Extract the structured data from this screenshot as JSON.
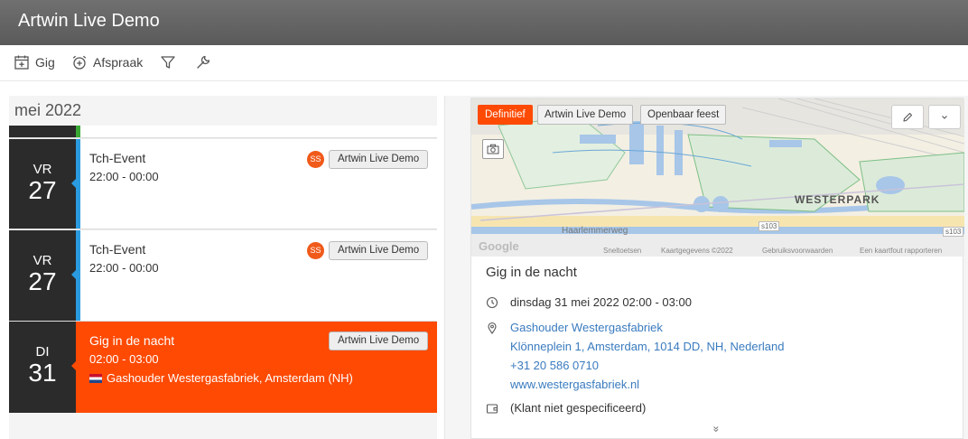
{
  "app": {
    "title": "Artwin Live Demo"
  },
  "toolbar": {
    "gig_label": "Gig",
    "afspraak_label": "Afspraak"
  },
  "list": {
    "month": "mei 2022",
    "events": [
      {
        "dow": "VR",
        "day": "27",
        "title": "Tch-Event",
        "time": "22:00 - 00:00",
        "avatar": "SS",
        "tag": "Artwin Live Demo"
      },
      {
        "dow": "VR",
        "day": "27",
        "title": "Tch-Event",
        "time": "22:00 - 00:00",
        "avatar": "SS",
        "tag": "Artwin Live Demo"
      },
      {
        "dow": "DI",
        "day": "31",
        "title": "Gig in de nacht",
        "time": "02:00 - 03:00",
        "location": "Gashouder Westergasfabriek, Amsterdam (NH)",
        "tag": "Artwin Live Demo"
      }
    ]
  },
  "detail": {
    "badges": [
      "Definitief",
      "Artwin Live Demo",
      "Openbaar feest"
    ],
    "map": {
      "district": "WESTERPARK",
      "street": "Haarlemmerweg",
      "road1": "s103",
      "road2": "s103",
      "google": "Google",
      "footer": [
        "Sneltoetsen",
        "Kaartgegevens ©2022",
        "Gebruiksvoorwaarden",
        "Een kaartfout rapporteren"
      ]
    },
    "title": "Gig in de nacht",
    "datetime": "dinsdag 31 mei 2022 02:00 - 03:00",
    "venue": {
      "name": "Gashouder Westergasfabriek",
      "address": "Klönneplein 1, Amsterdam, 1014 DD, NH, Nederland",
      "phone": "+31 20 586 0710",
      "website": "www.westergasfabriek.nl"
    },
    "client": "(Klant niet gespecificeerd)",
    "more": "»"
  },
  "colors": {
    "accent": "#fe4a03",
    "dark": "#2b2b2b",
    "blue_bar": "#2b9be0",
    "green_bar": "#3aa835"
  }
}
